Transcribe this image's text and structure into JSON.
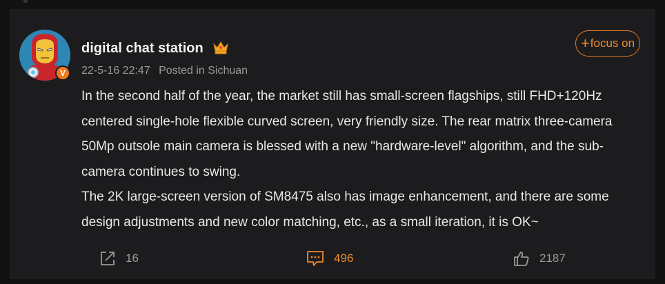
{
  "post": {
    "author": "digital chat station",
    "author_badge_icon": "crown-icon",
    "verified_badge": "V",
    "date": "22-5-16 22:47",
    "location": "Posted in Sichuan",
    "follow_plus": "+",
    "follow_label": "focus on",
    "paragraphs": [
      "In the second half of the year, the market still has small-screen flagships, still FHD+120Hz centered single-hole flexible curved screen, very friendly size. The rear matrix three-camera 50Mp outsole main camera is blessed with a new \"hardware-level\" algorithm, and the sub-camera continues to swing.",
      "The 2K large-screen version of SM8475 also has image enhancement, and there are some design adjustments and new color matching, etc., as a small iteration, it is OK~"
    ]
  },
  "actions": {
    "share_count": "16",
    "comment_count": "496",
    "like_count": "2187"
  },
  "colors": {
    "background": "#121212",
    "card": "#1c1c1e",
    "accent": "#f08a2a",
    "muted": "#9a9a9a"
  }
}
